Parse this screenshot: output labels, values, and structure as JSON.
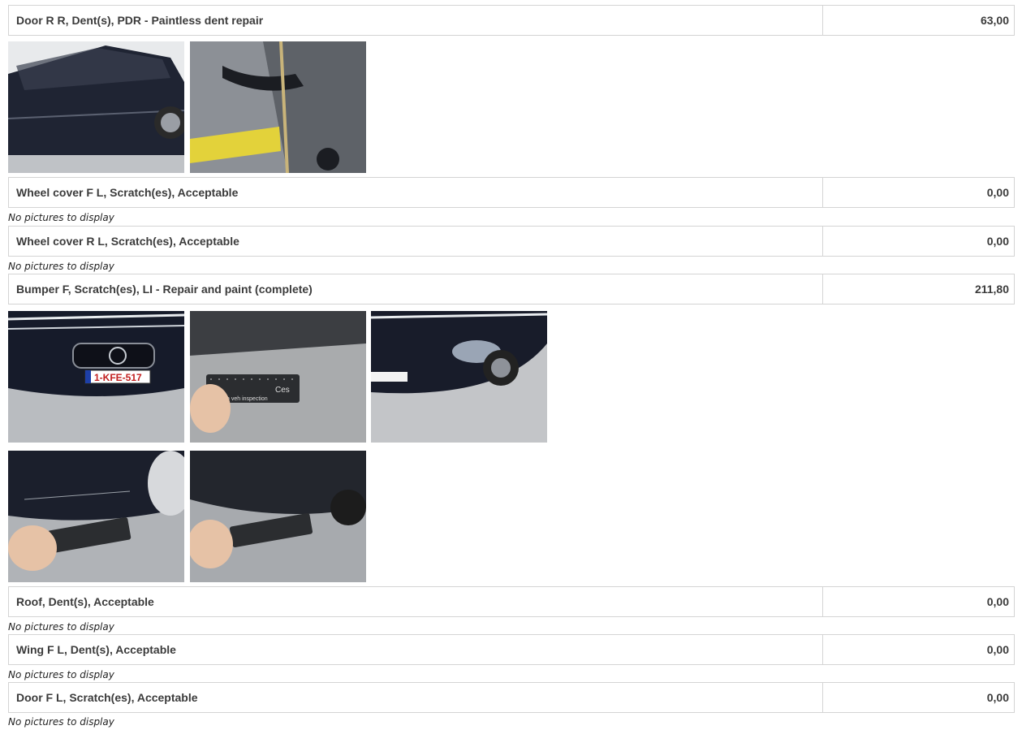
{
  "damages": [
    {
      "description": "Door R R, Dent(s), PDR - Paintless dent repair",
      "amount": "63,00"
    },
    {
      "description": "Wheel cover F L, Scratch(es), Acceptable",
      "amount": "0,00",
      "no_pictures": "No pictures to display"
    },
    {
      "description": "Wheel cover R L, Scratch(es), Acceptable",
      "amount": "0,00",
      "no_pictures": "No pictures to display"
    },
    {
      "description": "Bumper F, Scratch(es), LI - Repair and paint (complete)",
      "amount": "211,80"
    },
    {
      "description": "Roof, Dent(s), Acceptable",
      "amount": "0,00",
      "no_pictures": "No pictures to display"
    },
    {
      "description": "Wing F L, Dent(s), Acceptable",
      "amount": "0,00",
      "no_pictures": "No pictures to display"
    },
    {
      "description": "Door F L, Scratch(es), Acceptable",
      "amount": "0,00",
      "no_pictures": "No pictures to display"
    }
  ],
  "photos": {
    "plate_text": "1-KFE-517",
    "gauge_text": "acedam veh inspection",
    "gauge_brand": "Ces"
  }
}
